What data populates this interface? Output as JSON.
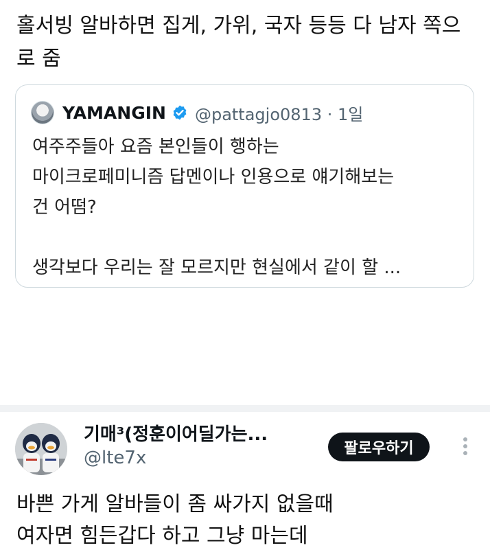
{
  "tweet1": {
    "text": "홀서빙 알바하면 집게, 가위, 국자 등등 다 남자 쪽으로 줌"
  },
  "quote": {
    "name": "YAMANGIN",
    "handle": "@pattagjo0813 · 1일",
    "body": "여주주들아 요즘 본인들이 행하는\n마이크로페미니즘 답멘이나 인용으로 얘기해보는\n건 어떰?\n\n생각보다 우리는 잘 모르지만 현실에서 같이 할 ..."
  },
  "tweet2": {
    "name": "기매³(정훈이어딜가는...",
    "handle": "@lte7x",
    "follow_label": "팔로우하기",
    "text": "바쁜 가게 알바들이 좀 싸가지 없을때\n여자면 힘든갑다 하고 그냥 마는데"
  },
  "colors": {
    "verified": "#1d9bf0",
    "follow_bg": "#0f1419"
  },
  "icons": {
    "verified": "verified-badge-icon",
    "more": "more-vertical-icon"
  }
}
